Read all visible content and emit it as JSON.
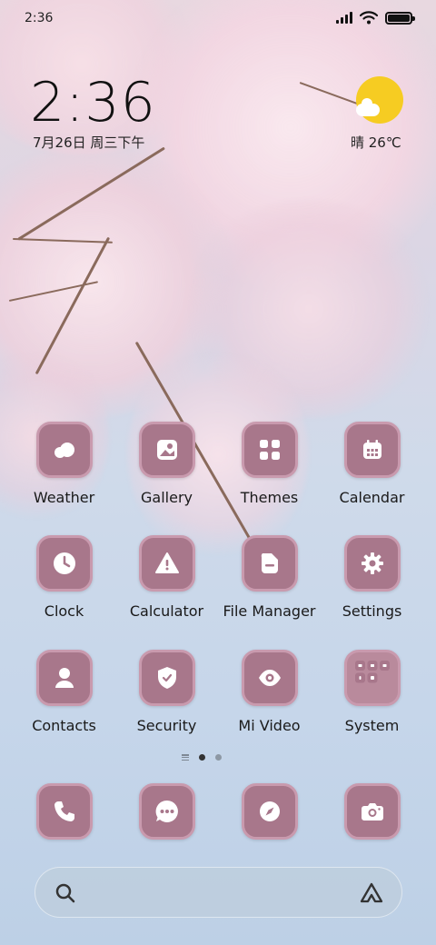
{
  "statusbar": {
    "time": "2:36"
  },
  "clock": {
    "time": "2:36",
    "date": "7月26日 周三下午"
  },
  "weather_widget": {
    "text": "晴 26℃",
    "icon": "sunny-cloud-icon"
  },
  "apps": [
    {
      "label": "Weather",
      "icon": "weather-icon"
    },
    {
      "label": "Gallery",
      "icon": "gallery-icon"
    },
    {
      "label": "Themes",
      "icon": "themes-icon"
    },
    {
      "label": "Calendar",
      "icon": "calendar-icon"
    },
    {
      "label": "Clock",
      "icon": "clock-icon"
    },
    {
      "label": "Calculator",
      "icon": "calculator-icon"
    },
    {
      "label": "File Manager",
      "icon": "file-manager-icon"
    },
    {
      "label": "Settings",
      "icon": "settings-icon"
    },
    {
      "label": "Contacts",
      "icon": "contacts-icon"
    },
    {
      "label": "Security",
      "icon": "security-icon"
    },
    {
      "label": "Mi Video",
      "icon": "mi-video-icon"
    },
    {
      "label": "System",
      "icon": "folder-icon"
    }
  ],
  "dock": [
    {
      "icon": "phone-icon"
    },
    {
      "icon": "messages-icon"
    },
    {
      "icon": "browser-icon"
    },
    {
      "icon": "camera-icon"
    }
  ],
  "page_indicator": {
    "pages": 2,
    "current": 1
  },
  "colors": {
    "icon_bg": "#a8778b",
    "icon_border": "#c99aae"
  }
}
